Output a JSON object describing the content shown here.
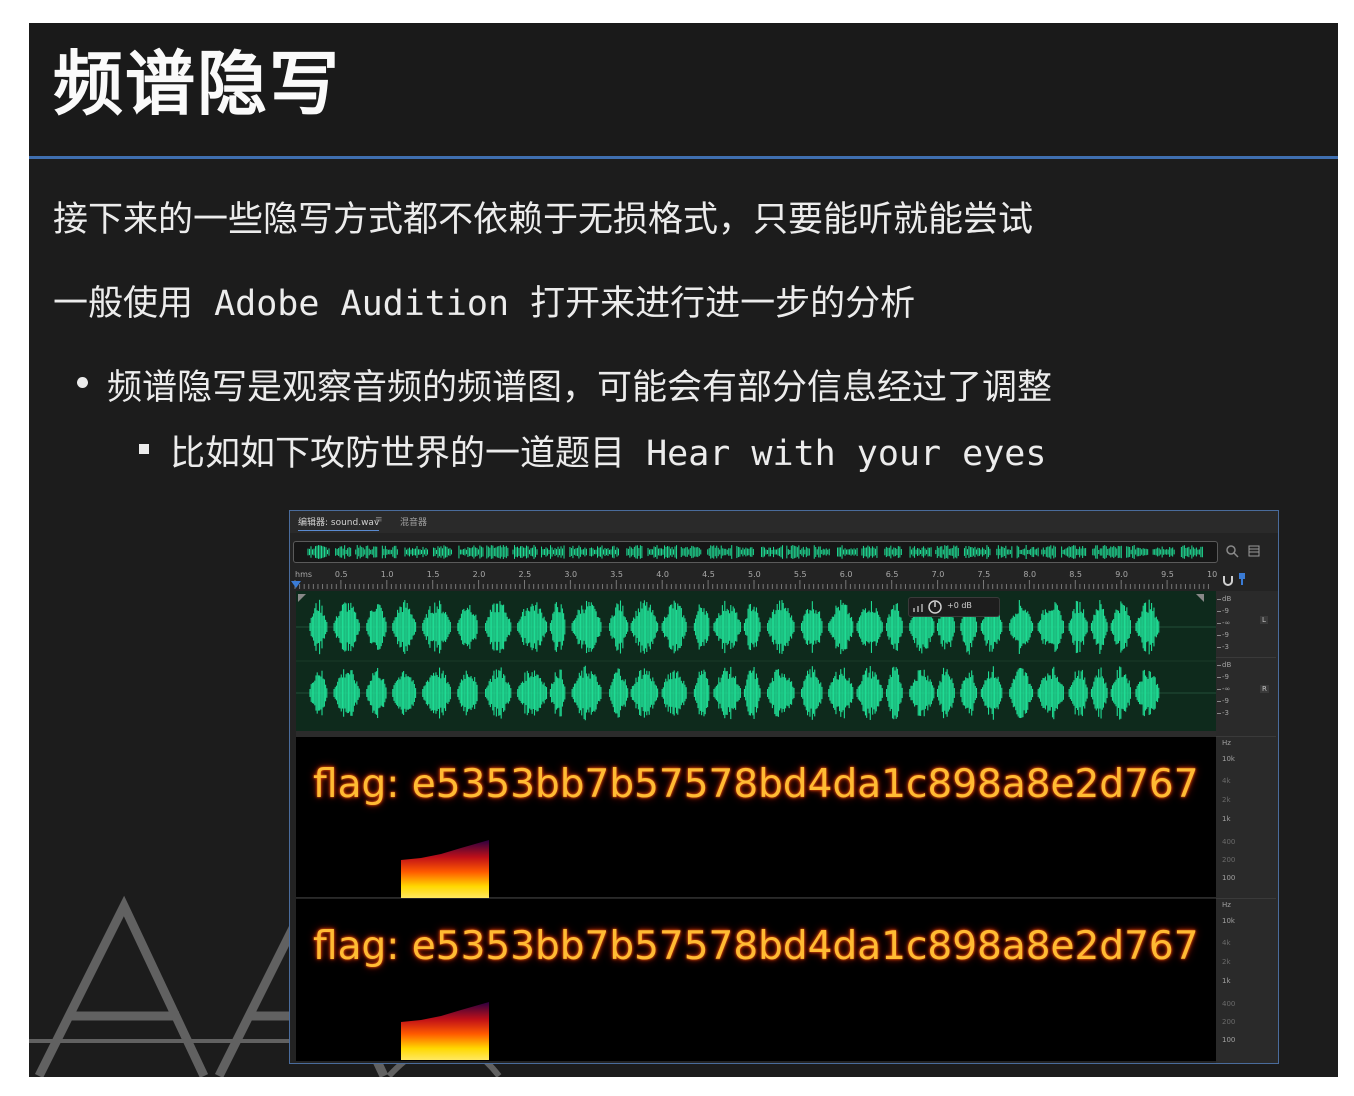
{
  "slide": {
    "title": "频谱隐写",
    "line1": "接下来的一些隐写方式都不依赖于无损格式，只要能听就能尝试",
    "line2": "一般使用 Adobe Audition 打开来进行进一步的分析",
    "bullet1": "频谱隐写是观察音频的频谱图，可能会有部分信息经过了调整",
    "bullet2": "比如如下攻防世界的一道题目 Hear with your eyes"
  },
  "audition": {
    "tabs": {
      "editor": "编辑器: sound.wav",
      "menu": "≡",
      "mixer": "混音器"
    },
    "ruler": {
      "unit": "hms",
      "ticks": [
        "0.5",
        "1.0",
        "1.5",
        "2.0",
        "2.5",
        "3.0",
        "3.5",
        "4.0",
        "4.5",
        "5.0",
        "5.5",
        "6.0",
        "6.5",
        "7.0",
        "7.5",
        "8.0",
        "8.5",
        "9.0",
        "9.5",
        "10"
      ]
    },
    "hud_gain": "+0 dB",
    "amp_scale": {
      "left": [
        "dB",
        "-9",
        "-∞",
        "-9",
        "-3"
      ],
      "right": [
        "dB",
        "-9",
        "-∞",
        "-9",
        "-3"
      ],
      "left_channel": "L",
      "right_channel": "R"
    },
    "freq_scale": {
      "unit": "Hz",
      "labels": [
        "10k",
        "4k",
        "2k",
        "1k",
        "400",
        "200",
        "100"
      ]
    },
    "spectrogram_text": "flag: e5353bb7b57578bd4da1c898a8e2d767",
    "colors": {
      "waveform": "#1fdc94",
      "waveform_bg": "#0e2a1c",
      "flag_text": "#ffbb33",
      "selection_blue": "#3a7bd5"
    }
  }
}
